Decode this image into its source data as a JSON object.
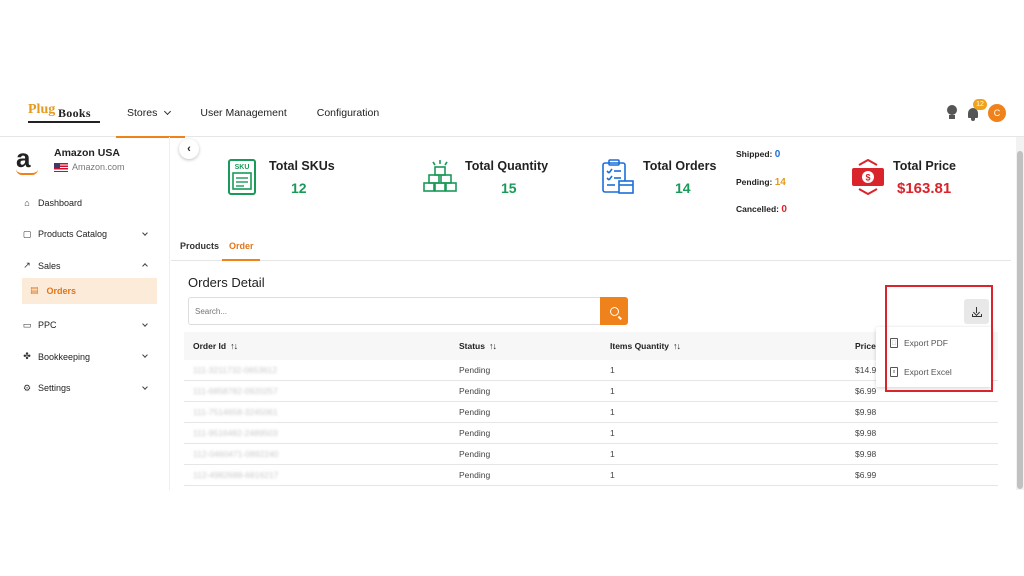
{
  "brand": {
    "part1": "Plug",
    "part2": "Books"
  },
  "nav": {
    "stores": "Stores",
    "user_management": "User Management",
    "configuration": "Configuration"
  },
  "header": {
    "notification_count": "12",
    "avatar_initial": "C"
  },
  "store": {
    "name": "Amazon USA",
    "domain": "Amazon.com",
    "logo_letter": "a"
  },
  "sidebar": {
    "dashboard": "Dashboard",
    "products_catalog": "Products Catalog",
    "sales": "Sales",
    "orders": "Orders",
    "ppc": "PPC",
    "bookkeeping": "Bookkeeping",
    "settings": "Settings"
  },
  "stats": {
    "total_skus": {
      "label": "Total SKUs",
      "value": "12",
      "icon_text": "SKU"
    },
    "total_quantity": {
      "label": "Total Quantity",
      "value": "15"
    },
    "total_orders": {
      "label": "Total Orders",
      "value": "14"
    },
    "shipped": {
      "label": "Shipped:",
      "value": "0"
    },
    "pending": {
      "label": "Pending:",
      "value": "14"
    },
    "cancelled": {
      "label": "Cancelled:",
      "value": "0"
    },
    "total_price": {
      "label": "Total Price",
      "value": "$163.81"
    }
  },
  "tabs": {
    "products": "Products",
    "order": "Order"
  },
  "orders_detail": {
    "title": "Orders Detail",
    "search_placeholder": "Search...",
    "columns": {
      "order_id": "Order Id",
      "status": "Status",
      "items_quantity": "Items Quantity",
      "price": "Price"
    },
    "rows": [
      {
        "id": "111-3211732-0653612",
        "status": "Pending",
        "qty": "1",
        "price": "$14.99"
      },
      {
        "id": "111-6858782-0920257",
        "status": "Pending",
        "qty": "1",
        "price": "$6.99"
      },
      {
        "id": "111-7514658-3245061",
        "status": "Pending",
        "qty": "1",
        "price": "$9.98"
      },
      {
        "id": "111-9516482-2489503",
        "status": "Pending",
        "qty": "1",
        "price": "$9.98"
      },
      {
        "id": "112-0460471-0892240",
        "status": "Pending",
        "qty": "1",
        "price": "$9.98"
      },
      {
        "id": "112-4982688-6816217",
        "status": "Pending",
        "qty": "1",
        "price": "$6.99"
      }
    ]
  },
  "export": {
    "pdf": "Export PDF",
    "excel": "Export Excel"
  },
  "colors": {
    "accent": "#f0821c",
    "green": "#1a9a58",
    "red": "#d9242c",
    "blue": "#1a6fd9"
  }
}
